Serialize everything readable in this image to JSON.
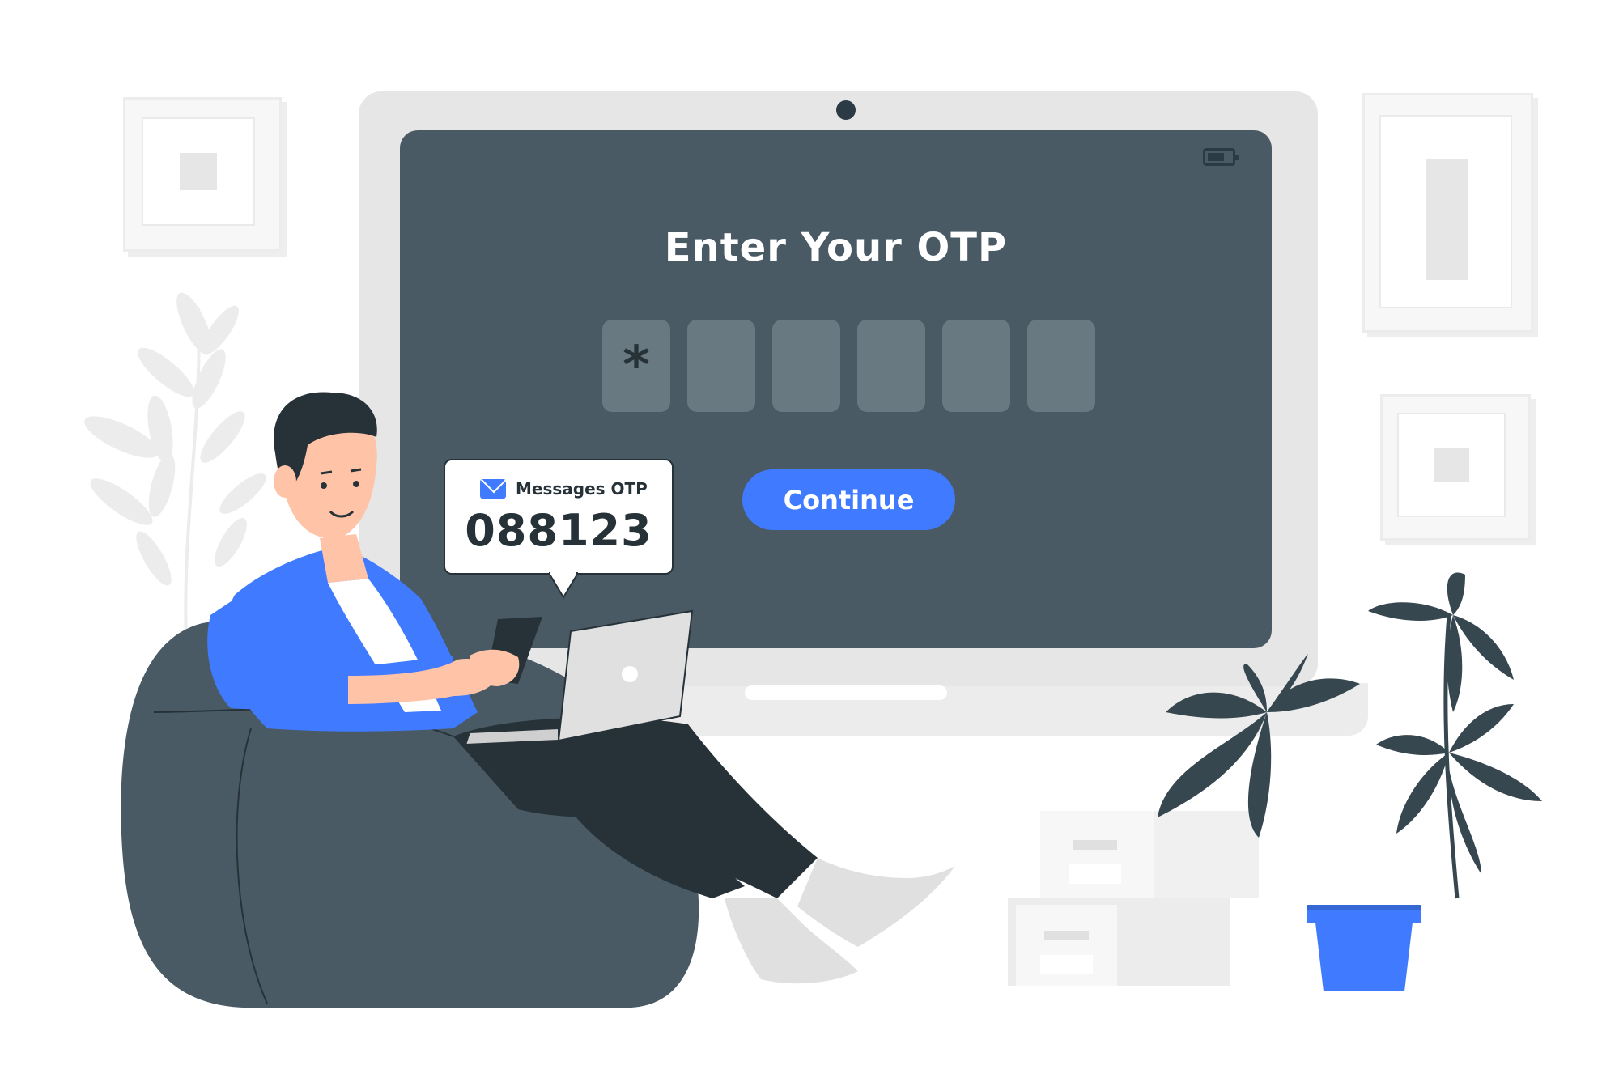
{
  "screen": {
    "title": "Enter Your OTP",
    "otp_digits": [
      "*",
      "",
      "",
      "",
      "",
      ""
    ],
    "continue_label": "Continue"
  },
  "notification": {
    "label": "Messages OTP",
    "code": "088123"
  },
  "colors": {
    "accent": "#407bff",
    "screen": "#4a5a65",
    "dark": "#263238",
    "light_gray": "#e6e6e6"
  }
}
